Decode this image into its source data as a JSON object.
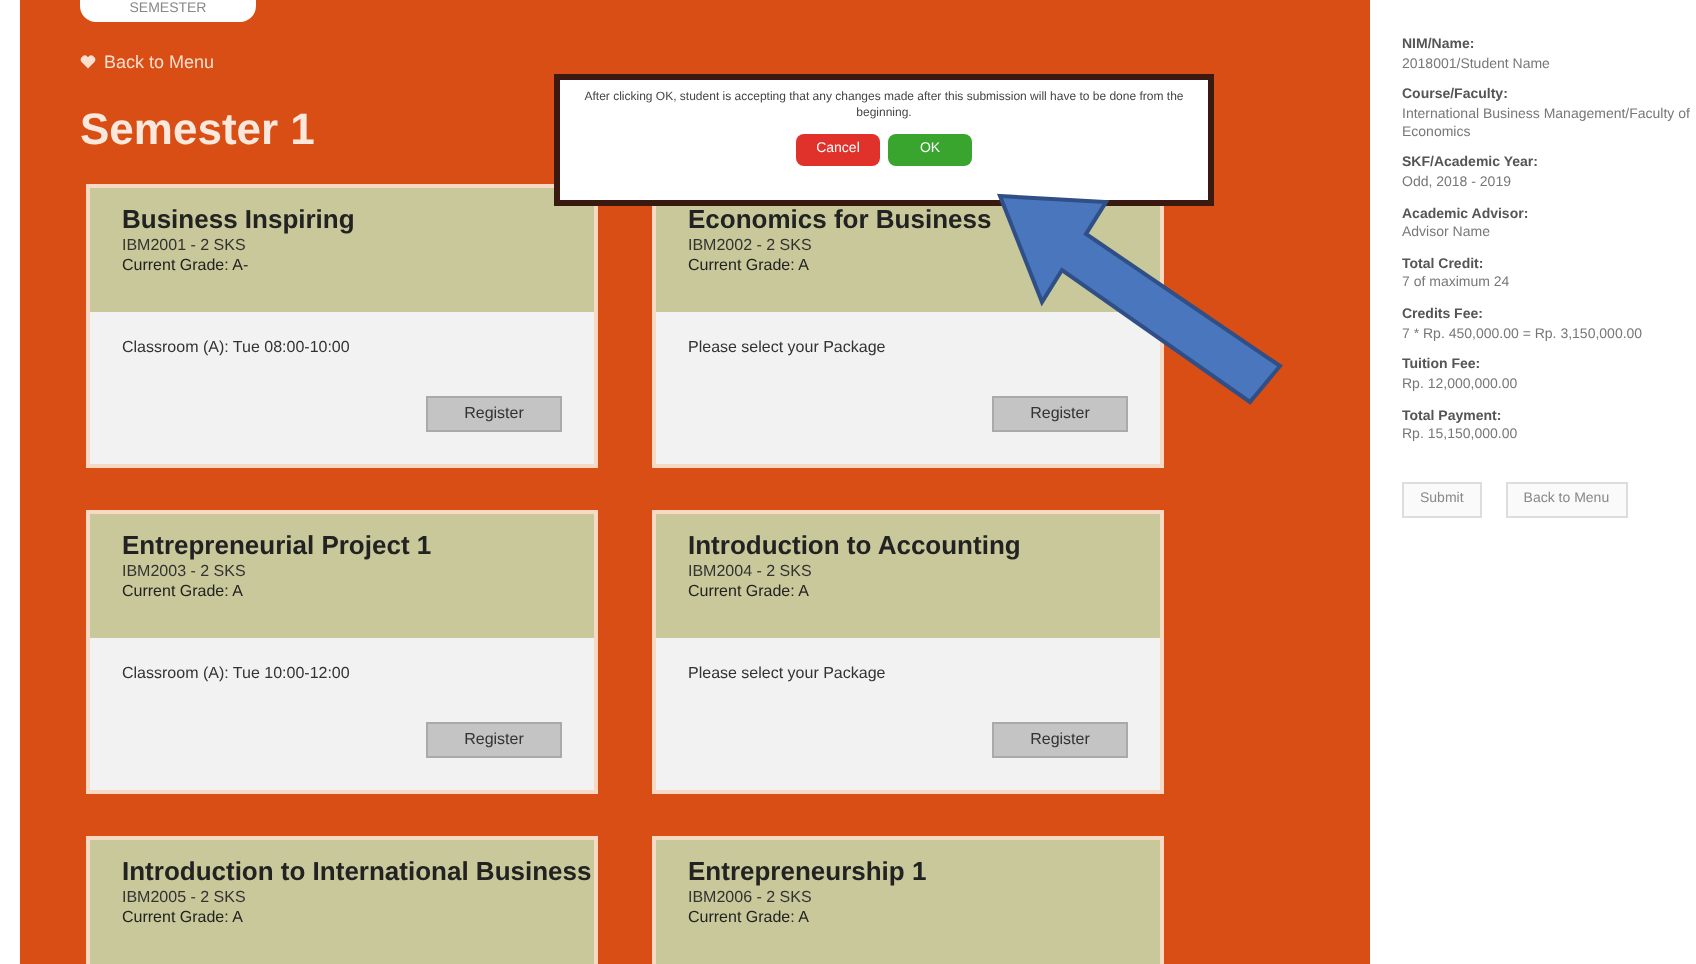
{
  "top_tab": {
    "label": "SEMESTER"
  },
  "back_link": {
    "label": "Back to Menu"
  },
  "heading": "Semester 1",
  "dialog": {
    "message": "After clicking OK, student is accepting that any changes made after this submission will have to be done from the beginning.",
    "buttons": [
      {
        "label": "Cancel",
        "kind": "cancel"
      },
      {
        "label": "OK",
        "kind": "confirm"
      }
    ]
  },
  "courses": [
    {
      "name": "Business Inspiring",
      "code": "IBM2001 - 2 SKS",
      "grade": "Current Grade: A-",
      "info": "Classroom (A): Tue 08:00-10:00",
      "button": "Register"
    },
    {
      "name": "Economics for Business",
      "code": "IBM2002 - 2 SKS",
      "grade": "Current Grade: A",
      "info": "Please select your Package",
      "button": "Register"
    },
    {
      "name": "Entrepreneurial Project 1",
      "code": "IBM2003 - 2 SKS",
      "grade": "Current Grade: A",
      "info": "Classroom (A): Tue 10:00-12:00",
      "button": "Register"
    },
    {
      "name": "Introduction to Accounting",
      "code": "IBM2004 - 2 SKS",
      "grade": "Current Grade: A",
      "info": "Please select your Package",
      "button": "Register"
    },
    {
      "name": "Introduction to International Business",
      "code": "IBM2005 - 2 SKS",
      "grade": "Current Grade: A"
    },
    {
      "name": "Entrepreneurship 1",
      "code": "IBM2006 - 2 SKS",
      "grade": "Current Grade: A"
    }
  ],
  "sidebar": {
    "fields": [
      {
        "label": "NIM/Name:",
        "value": "2018001/Student Name"
      },
      {
        "label": "Course/Faculty:",
        "value": "International Business Management/Faculty of Economics"
      },
      {
        "label": "SKF/Academic Year:",
        "value": "Odd, 2018 - 2019"
      },
      {
        "label": "Academic Advisor:",
        "value": "Advisor Name"
      },
      {
        "label": "Total Credit:",
        "value": "7 of maximum 24"
      },
      {
        "label": "Credits Fee:",
        "value": "7 * Rp. 450,000.00 = Rp. 3,150,000.00"
      },
      {
        "label": "Tuition Fee:",
        "value": "Rp. 12,000,000.00"
      },
      {
        "label": "Total Payment:",
        "value": "Rp. 15,150,000.00"
      }
    ],
    "buttons": [
      "Submit",
      "Back to Menu"
    ]
  }
}
